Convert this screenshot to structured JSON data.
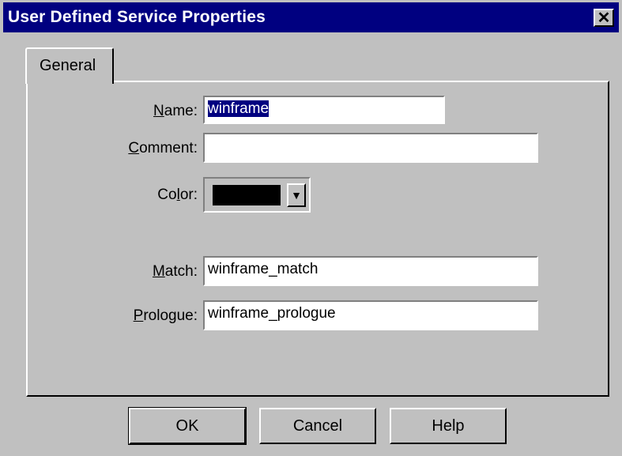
{
  "window": {
    "title": "User Defined Service Properties",
    "close_glyph": "✕"
  },
  "tabs": [
    {
      "label": "General"
    }
  ],
  "form": {
    "name": {
      "label": "Name:",
      "mnemonic": "N",
      "rest": "ame:",
      "value": "winframe"
    },
    "comment": {
      "label": "Comment:",
      "mnemonic": "C",
      "rest": "omment:",
      "value": ""
    },
    "color": {
      "label": "Color:",
      "pre": "Co",
      "mnemonic": "l",
      "rest": "or:",
      "value": "#000000"
    },
    "match": {
      "label": "Match:",
      "mnemonic": "M",
      "rest": "atch:",
      "value": "winframe_match"
    },
    "prologue": {
      "label": "Prologue:",
      "mnemonic": "P",
      "rest": "rologue:",
      "value": "winframe_prologue"
    }
  },
  "buttons": {
    "ok": "OK",
    "cancel": "Cancel",
    "help": "Help"
  },
  "colors": {
    "titlebar": "#000080",
    "face": "#c0c0c0",
    "selection": "#000080"
  }
}
